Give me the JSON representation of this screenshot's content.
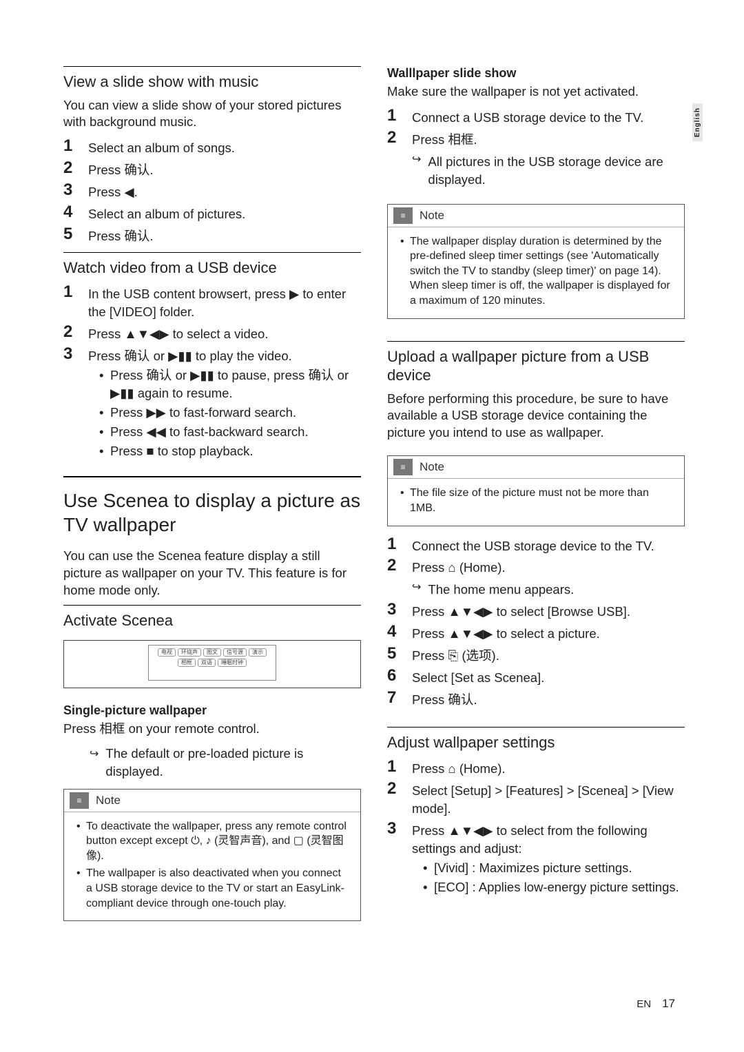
{
  "side_tab": "English",
  "footer": {
    "lang": "EN",
    "page": "17"
  },
  "left": {
    "s1": {
      "head": "View a slide show with music",
      "intro": "You can view a slide show of your stored pictures with background music.",
      "steps": [
        "Select an album of songs.",
        "Press 确认.",
        "Press ◀.",
        "Select an album of pictures.",
        "Press 确认."
      ]
    },
    "s2": {
      "head": "Watch video from a USB device",
      "steps": [
        "In the USB content browsert, press ▶ to enter the [VIDEO] folder.",
        "Press ▲▼◀▶ to select a video.",
        "Press 确认 or ▶▮▮ to play the video."
      ],
      "bullets": [
        "Press 确认 or ▶▮▮ to pause, press 确认 or ▶▮▮ again to resume.",
        "Press ▶▶ to fast-forward search.",
        "Press ◀◀ to fast-backward search.",
        "Press ■ to stop playback."
      ]
    },
    "sect": {
      "head": "Use Scenea to display a picture as TV wallpaper",
      "intro": "You can use the Scenea feature display a still picture as wallpaper on your TV. This feature is for home mode only."
    },
    "s3": {
      "head": "Activate Scenea"
    },
    "single": {
      "head": "Single-picture wallpaper",
      "body": "Press 相框 on your remote control.",
      "sub": "The default or pre-loaded picture is displayed."
    },
    "note1": {
      "label": "Note",
      "items": [
        "To deactivate the wallpaper, press any remote control button except except ⏻, ♪ (灵智声音), and ▢ (灵智图像).",
        "The wallpaper is also deactivated when you connect a USB storage device to the TV or start an EasyLink-compliant device through one-touch play."
      ]
    }
  },
  "right": {
    "wall": {
      "head": "Walllpaper slide show",
      "intro": "Make sure the wallpaper is not yet activated.",
      "steps": [
        "Connect a USB storage device to the TV.",
        "Press 相框."
      ],
      "sub": "All pictures in the USB storage device are displayed."
    },
    "note2": {
      "label": "Note",
      "items": [
        "The wallpaper display duration is determined by the pre-defined sleep timer settings (see 'Automatically switch the TV to standby (sleep timer)' on page 14). When sleep timer is off, the wallpaper is displayed for a maximum of 120 minutes."
      ]
    },
    "upload": {
      "head": "Upload a wallpaper picture from a USB device",
      "intro": "Before performing this procedure, be sure to have available a USB storage device containing the picture you intend to use as wallpaper."
    },
    "note3": {
      "label": "Note",
      "items": [
        "The file size of the picture must not be more than 1MB."
      ]
    },
    "upload_steps": [
      "Connect the USB storage device to the TV.",
      "Press ⌂ (Home).",
      "Press ▲▼◀▶ to select [Browse USB].",
      "Press ▲▼◀▶ to select a picture.",
      "Press ⎘ (选项).",
      "Select [Set as Scenea].",
      "Press 确认."
    ],
    "upload_sub": "The home menu appears.",
    "adjust": {
      "head": "Adjust wallpaper settings",
      "steps": [
        "Press ⌂ (Home).",
        "Select [Setup] > [Features] > [Scenea] > [View mode].",
        "Press ▲▼◀▶ to select from the following settings and adjust:"
      ],
      "bullets": [
        "[Vivid] : Maximizes picture settings.",
        "[ECO] : Applies low-energy picture settings."
      ]
    }
  },
  "remote_keys": [
    "电视",
    "环绕声",
    "图文",
    "信号源",
    "演示",
    "相框",
    "双语",
    "睡眠时钟"
  ]
}
